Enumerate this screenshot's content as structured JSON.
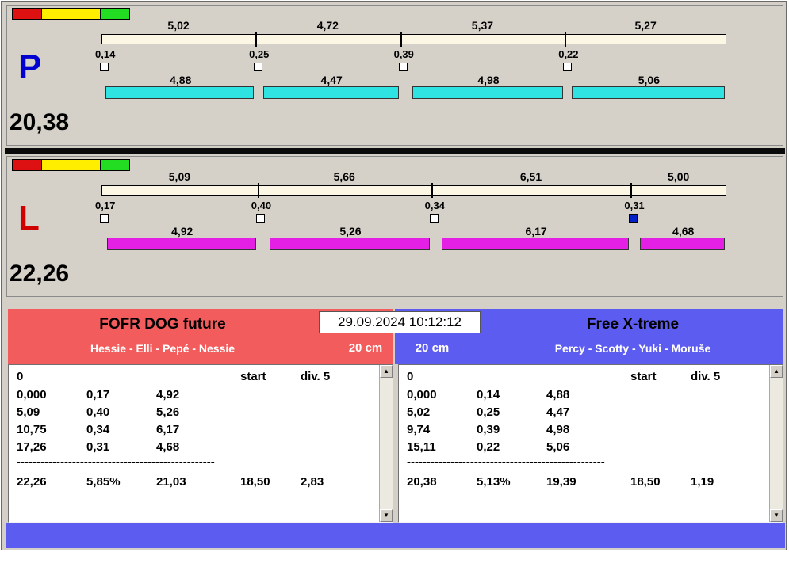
{
  "datetime": "29.09.2024 10:12:12",
  "icons": {
    "up_arrow": "▲",
    "down_arrow": "▼"
  },
  "colors": {
    "window_bg": "#d4d0c8",
    "checkbox_fill": "#0020c8",
    "bottom_strip": "#5c5cf0"
  },
  "lanes": [
    {
      "letter": "P",
      "letter_color": "#0000d0",
      "bar_color": "#2fe3e3",
      "total": "20,38",
      "total_value": 20.38,
      "segments": [
        5.02,
        4.72,
        5.37,
        5.27
      ],
      "segment_labels": [
        "5,02",
        "4,72",
        "5,37",
        "5,27"
      ],
      "crossovers": [
        0.14,
        0.25,
        0.39,
        0.22
      ],
      "crossover_labels": [
        "0,14",
        "0,25",
        "0,39",
        "0,22"
      ],
      "dogs": [
        4.88,
        4.47,
        4.98,
        5.06
      ],
      "dog_labels": [
        "4,88",
        "4,47",
        "4,98",
        "5,06"
      ],
      "checkbox_filled": [
        false,
        false,
        false,
        false
      ],
      "lights": [
        "#dd1111",
        "#ffee00",
        "#ffee00",
        "#22dd22"
      ]
    },
    {
      "letter": "L",
      "letter_color": "#d00000",
      "bar_color": "#e520e5",
      "total": "22,26",
      "total_value": 22.26,
      "segments": [
        5.09,
        5.66,
        6.51,
        5.0
      ],
      "segment_labels": [
        "5,09",
        "5,66",
        "6,51",
        "5,00"
      ],
      "crossovers": [
        0.17,
        0.4,
        0.34,
        0.31
      ],
      "crossover_labels": [
        "0,17",
        "0,40",
        "0,34",
        "0,31"
      ],
      "dogs": [
        4.92,
        5.26,
        6.17,
        4.68
      ],
      "dog_labels": [
        "4,92",
        "5,26",
        "6,17",
        "4,68"
      ],
      "checkbox_filled": [
        false,
        false,
        false,
        true
      ],
      "lights": [
        "#dd1111",
        "#ffee00",
        "#ffee00",
        "#22dd22"
      ]
    }
  ],
  "teams": [
    {
      "name": "FOFR DOG future",
      "dogs_line": "Hessie - Elli - Pepé - Nessie",
      "height": "20 cm",
      "header_bg": "#f25c5c",
      "table": {
        "header": {
          "col1": "0",
          "start": "start",
          "div": "div. 5"
        },
        "rows": [
          [
            "0,000",
            "0,17",
            "4,92"
          ],
          [
            "5,09",
            "0,40",
            "5,26"
          ],
          [
            "10,75",
            "0,34",
            "6,17"
          ],
          [
            "17,26",
            "0,31",
            "4,68"
          ]
        ],
        "dashes": "--------------------------------------------------",
        "totals": [
          "22,26",
          "5,85%",
          "21,03",
          "18,50",
          "2,83"
        ]
      }
    },
    {
      "name": "Free X-treme",
      "dogs_line": "Percy - Scotty - Yuki - Moruše",
      "height": "20 cm",
      "header_bg": "#5c5cf0",
      "table": {
        "header": {
          "col1": "0",
          "start": "start",
          "div": "div. 5"
        },
        "rows": [
          [
            "0,000",
            "0,14",
            "4,88"
          ],
          [
            "5,02",
            "0,25",
            "4,47"
          ],
          [
            "9,74",
            "0,39",
            "4,98"
          ],
          [
            "15,11",
            "0,22",
            "5,06"
          ]
        ],
        "dashes": "--------------------------------------------------",
        "totals": [
          "20,38",
          "5,13%",
          "19,39",
          "18,50",
          "1,19"
        ]
      }
    }
  ]
}
